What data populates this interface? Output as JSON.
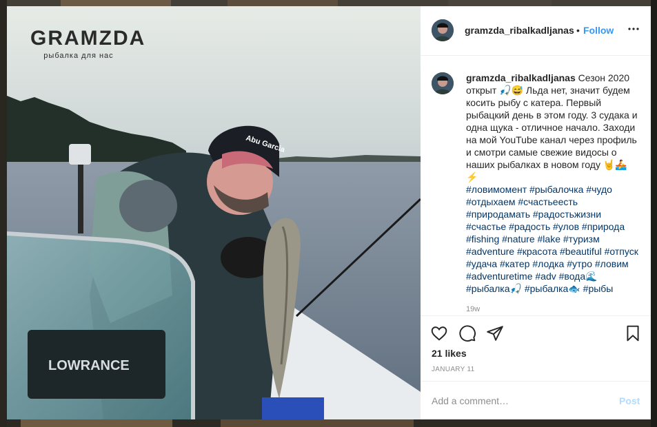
{
  "post": {
    "logo": {
      "title": "GRAMZDA",
      "subtitle": "рыбалка для нас"
    },
    "photo": {
      "boat_brand_text": "LOWRANCE",
      "cap_text": "Abu Garcia"
    }
  },
  "header": {
    "username": "gramzda_ribalkadljanas",
    "separator": "•",
    "follow_label": "Follow",
    "more_icon": "more-horizontal-icon"
  },
  "caption": {
    "username": "gramzda_ribalkadljanas",
    "text": "Сезон 2020 открыт 🎣😅 Льда нет, значит будем косить рыбу с катера. Первый рыбацкий день в этом году. 3 судака и одна щука - отличное начало. Заходи на мой YouTube канал через профиль и смотри самые свежие видосы о наших рыбалках в новом году 🤘🚣⚡",
    "hashtags": "#ловимомент #рыбалочка #чудо #отдыхаем #счастьеесть #природамать #радостьжизни #счастье #радость #улов #природа #fishing #nature #lake #туризм #adventure #красота #beautiful #отпуск #удача #катер #лодка #утро #ловим #adventuretime #adv #вода🌊 #рыбалка🎣 #рыбалка🐟 #рыбы",
    "time_ago": "19w"
  },
  "actions": {
    "like_icon": "heart-icon",
    "comment_icon": "comment-icon",
    "share_icon": "send-icon",
    "save_icon": "bookmark-icon",
    "likes": "21 likes",
    "date": "JANUARY 11"
  },
  "comment_box": {
    "placeholder": "Add a comment…",
    "post_label": "Post"
  },
  "colors": {
    "link": "#3897f0",
    "hashtag": "#00376b",
    "muted": "#8e8e8e",
    "post_disabled": "#b3dbff"
  }
}
